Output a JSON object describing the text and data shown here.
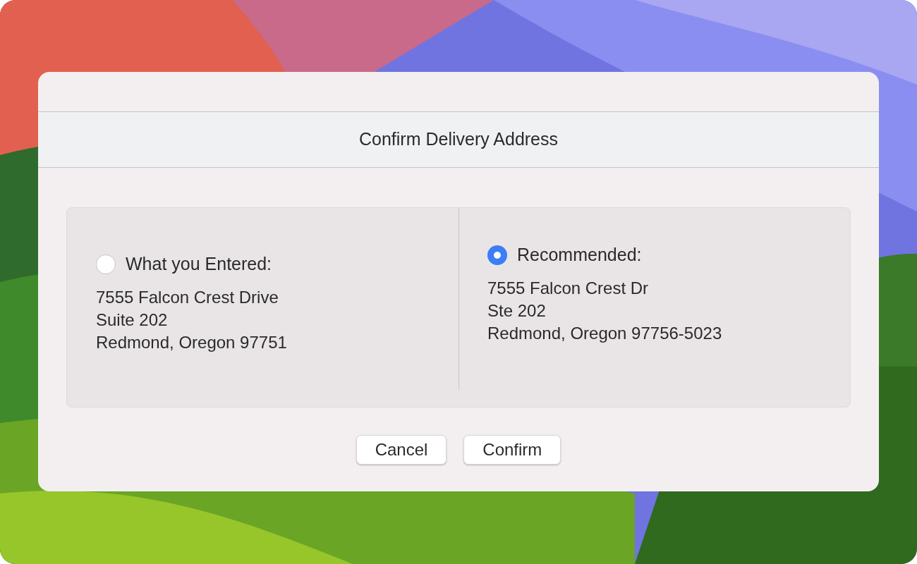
{
  "dialog": {
    "title": "Confirm Delivery Address",
    "options": [
      {
        "label": "What you Entered:",
        "selected": false,
        "lines": [
          "7555 Falcon Crest Drive",
          "Suite 202",
          "Redmond, Oregon 97751"
        ]
      },
      {
        "label": "Recommended:",
        "selected": true,
        "lines": [
          "7555 Falcon Crest Dr",
          "Ste 202",
          "Redmond, Oregon 97756-5023"
        ]
      }
    ],
    "buttons": [
      {
        "label": "Cancel"
      },
      {
        "label": "Confirm"
      }
    ]
  }
}
